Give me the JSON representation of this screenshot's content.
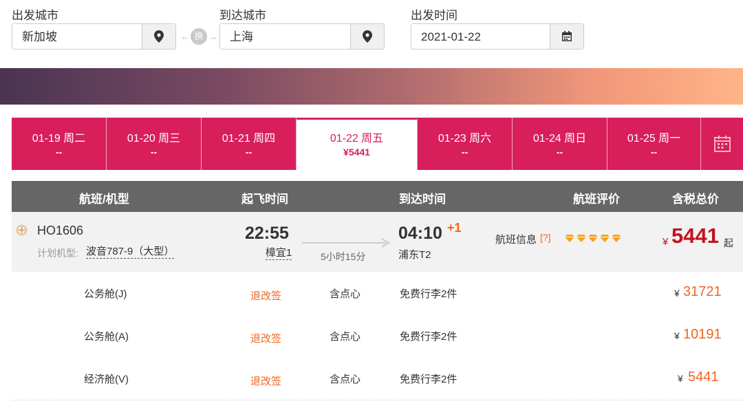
{
  "search": {
    "from_label": "出发城市",
    "from_value": "新加坡",
    "to_label": "到达城市",
    "to_value": "上海",
    "swap_text": "换",
    "date_label": "出发时间",
    "date_value": "2021-01-22"
  },
  "date_tabs": [
    {
      "date": "01-19 周二",
      "price": "--"
    },
    {
      "date": "01-20 周三",
      "price": "--"
    },
    {
      "date": "01-21 周四",
      "price": "--"
    },
    {
      "date": "01-22 周五",
      "price": "¥5441"
    },
    {
      "date": "01-23 周六",
      "price": "--"
    },
    {
      "date": "01-24 周日",
      "price": "--"
    },
    {
      "date": "01-25 周一",
      "price": "--"
    }
  ],
  "table_header": {
    "flight": "航班/机型",
    "depart": "起飞时间",
    "arrive": "到达时间",
    "rating": "航班评价",
    "price": "含税总价"
  },
  "flight": {
    "number": "HO1606",
    "aircraft_label": "计划机型:",
    "aircraft": "波音787-9（大型）",
    "depart_time": "22:55",
    "depart_airport": "樟宜1",
    "duration": "5小时15分",
    "arrive_time": "04:10",
    "day_offset": "+1",
    "arrive_airport": "浦东T2",
    "info_label": "航班信息",
    "info_help": "[?]",
    "rating_count": 5,
    "price_symbol": "¥",
    "price": "5441",
    "price_suffix": "起"
  },
  "cabins": [
    {
      "name": "公务舱(J)",
      "rules": "退改签",
      "meal": "含点心",
      "baggage": "免费行李2件",
      "symbol": "¥",
      "price": "31721"
    },
    {
      "name": "公务舱(A)",
      "rules": "退改签",
      "meal": "含点心",
      "baggage": "免费行李2件",
      "symbol": "¥",
      "price": "10191"
    },
    {
      "name": "经济舱(V)",
      "rules": "退改签",
      "meal": "含点心",
      "baggage": "免费行李2件",
      "symbol": "¥",
      "price": "5441"
    }
  ],
  "colors": {
    "accent": "#d81e5b",
    "price_main": "#c0141e",
    "price_cabin": "#f26522",
    "rules_link": "#f26522",
    "rating_diamond": "#f7a21a"
  }
}
